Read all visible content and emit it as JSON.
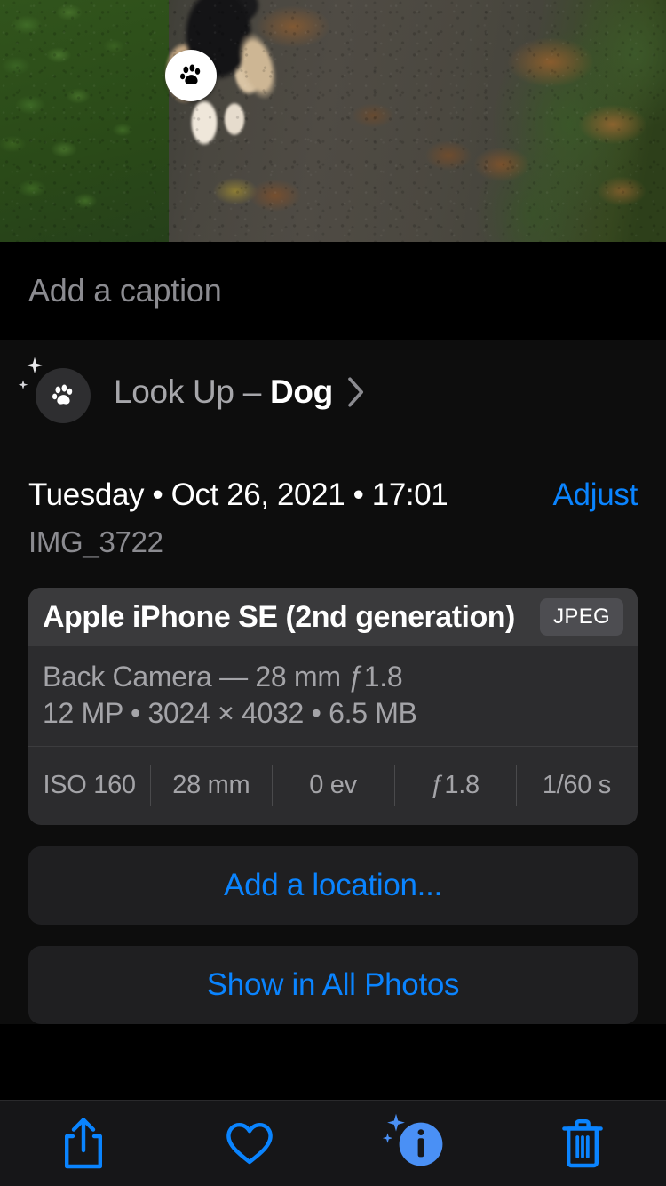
{
  "photo": {
    "alt_description": "dog on dirt path with autumn leaves",
    "badge_icon": "paw-icon"
  },
  "caption": {
    "placeholder": "Add a caption",
    "value": ""
  },
  "lookup": {
    "icon": "paw-icon",
    "sparkle_icon": "sparkles-icon",
    "label_prefix": "Look Up – ",
    "subject": "Dog",
    "chevron_icon": "chevron-right-icon"
  },
  "details": {
    "date": "Tuesday • Oct 26, 2021 • 17:01",
    "adjust_label": "Adjust",
    "filename": "IMG_3722"
  },
  "exif": {
    "model": "Apple iPhone SE (2nd generation)",
    "format": "JPEG",
    "lens_line": "Back Camera — 28 mm ƒ1.8",
    "size_line": "12 MP • 3024 × 4032 • 6.5 MB",
    "stats": [
      {
        "name": "iso",
        "value": "ISO 160"
      },
      {
        "name": "focal-length",
        "value": "28 mm"
      },
      {
        "name": "exposure-bias",
        "value": "0 ev"
      },
      {
        "name": "aperture",
        "value": "ƒ1.8"
      },
      {
        "name": "shutter-speed",
        "value": "1/60 s"
      }
    ]
  },
  "actions": {
    "add_location": "Add a location...",
    "show_in_all_photos": "Show in All Photos"
  },
  "toolbar": {
    "items": [
      {
        "name": "share-icon",
        "label": "Share"
      },
      {
        "name": "heart-icon",
        "label": "Favorite"
      },
      {
        "name": "info-icon",
        "label": "Info"
      },
      {
        "name": "trash-icon",
        "label": "Delete"
      }
    ]
  },
  "colors": {
    "accent_blue": "#0a84ff",
    "page_background": "#0d0d0d",
    "card_background": "#2c2c2e",
    "card_header": "#3a3a3c",
    "secondary_text": "#a4a4a8"
  }
}
